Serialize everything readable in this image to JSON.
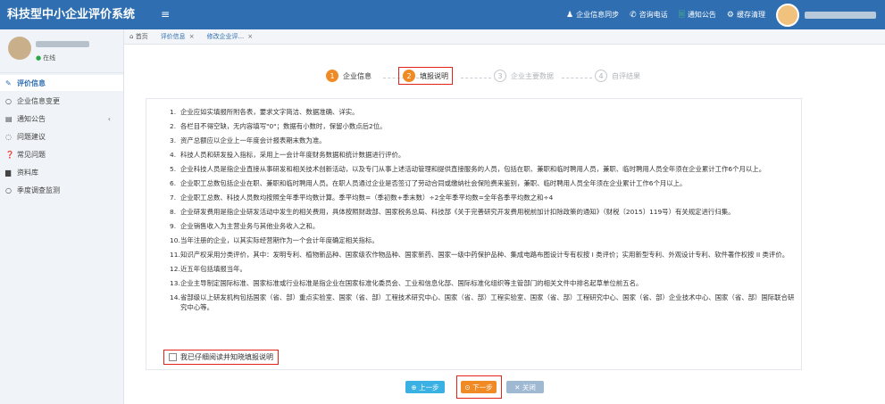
{
  "app": {
    "title": "科技型中小企业评价系统",
    "menu_icon": "≡"
  },
  "topnav": [
    {
      "icon": "user-icon",
      "glyph": "♟",
      "label": "企业信息同步"
    },
    {
      "icon": "phone-icon",
      "glyph": "✆",
      "label": "咨询电话"
    },
    {
      "icon": "notice-icon",
      "glyph": "🗏",
      "label": "通知公告"
    },
    {
      "icon": "cache-icon",
      "glyph": "⚙",
      "label": "缓存清理"
    }
  ],
  "sidebar": {
    "online": "在线",
    "items": [
      {
        "icon": "edit-icon",
        "glyph": "✎",
        "label": "评价信息",
        "active": true
      },
      {
        "icon": "circle-icon",
        "glyph": "○",
        "label": "企业信息变更"
      },
      {
        "icon": "notice-icon",
        "glyph": "▤",
        "label": "通知公告",
        "arrow": "‹"
      },
      {
        "icon": "chat-icon",
        "glyph": "◌",
        "label": "问题建议"
      },
      {
        "icon": "question-icon",
        "glyph": "❓",
        "label": "常见问题"
      },
      {
        "icon": "folder-icon",
        "glyph": "▆",
        "label": "资料库"
      },
      {
        "icon": "circle-icon",
        "glyph": "○",
        "label": "季度调查监测"
      }
    ]
  },
  "tabs": {
    "home": "首页",
    "items": [
      {
        "label": "评价信息",
        "close": "×"
      },
      {
        "label": "修改企业评...",
        "close": "×"
      }
    ]
  },
  "steps": [
    {
      "num": "1",
      "label": "企业信息",
      "state": "done"
    },
    {
      "num": "2",
      "label": "填报说明",
      "state": "current"
    },
    {
      "num": "3",
      "label": "企业主要数据",
      "state": "todo"
    },
    {
      "num": "4",
      "label": "自评结果",
      "state": "todo"
    }
  ],
  "instructions": [
    {
      "n": "1.",
      "t": "企业应如实填报所附各表，要求文字简洁、数据准确、详实。"
    },
    {
      "n": "2.",
      "t": "各栏目不得空缺，无内容填写\"0\"；数据有小数时，保留小数点后2位。"
    },
    {
      "n": "3.",
      "t": "资产总额应以企业上一年度会计报表期末数为准。"
    },
    {
      "n": "4.",
      "t": "科技人员和研发投入指标，采用上一会计年度财务数据和统计数据进行评价。"
    },
    {
      "n": "5.",
      "t": "企业科技人员是指企业直接从事研发和相关技术创新活动，以及专门从事上述活动管理和提供直接服务的人员，包括在职、兼职和临时聘用人员，兼职、临时聘用人员全年须在企业累计工作6个月以上。"
    },
    {
      "n": "6.",
      "t": "企业职工总数包括企业在职、兼职和临时聘用人员。在职人员通过企业是否签订了劳动合同或缴纳社会保险费来鉴别，兼职、临时聘用人员全年须在企业累计工作6个月以上。"
    },
    {
      "n": "7.",
      "t": "企业职工总数、科技人员数均按照全年季平均数计算。季平均数=（季初数+季末数）÷2全年季平均数=全年各季平均数之和÷4"
    },
    {
      "n": "8.",
      "t": "企业研发费用是指企业研发活动中发生的相关费用，具体按照财政部、国家税务总局、科技部《关于完善研究开发费用税前加计扣除政策的通知》（财税〔2015〕119号）有关规定进行归集。"
    },
    {
      "n": "9.",
      "t": "企业销售收入为主营业务与其他业务收入之和。"
    },
    {
      "n": "10.",
      "t": "当年注册的企业，以其实际经营期作为一个会计年度确定相关指标。"
    },
    {
      "n": "11.",
      "t": "知识产权采用分类评价，其中：发明专利、植物新品种、国家级农作物品种、国家新药、国家一级中药保护品种、集成电路布图设计专有权按 I 类评价；实用新型专利、外观设计专利、软件著作权按 II 类评价。"
    },
    {
      "n": "12.",
      "t": "近五年包括填报当年。"
    },
    {
      "n": "13.",
      "t": "企业主导制定国际标准、国家标准或行业标准是指企业在国家标准化委员会、工业和信息化部、国际标准化组织等主管部门的相关文件中排名起草单位前五名。"
    },
    {
      "n": "14.",
      "t": "省部级以上研发机构包括国家（省、部）重点实验室、国家（省、部）工程技术研究中心、国家（省、部）工程实验室、国家（省、部）工程研究中心、国家（省、部）企业技术中心、国家（省、部）国际联合研究中心等。"
    }
  ],
  "agree_label": "我已仔细阅读并知晓填报说明",
  "buttons": {
    "prev": "⊕ 上一步",
    "next": "⊙ 下一步",
    "close": "✕ 关闭"
  }
}
